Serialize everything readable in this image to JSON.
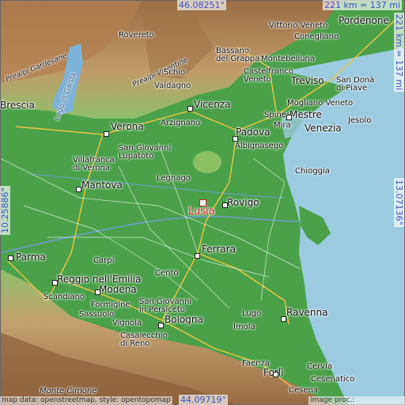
{
  "colors": {
    "lowland": "#4aa14a",
    "mountain": "#b08a5a",
    "sea": "#9ccbe0",
    "marker": "#e0212b",
    "coord": "#3b52c4"
  },
  "coords": {
    "top": "46.08251°",
    "bottom": "44.09719°",
    "left": "10.25886°",
    "right": "13.07136°",
    "scale_top": "221 km = 137 mi",
    "scale_right": "221 km = 137 mi"
  },
  "target": {
    "name": "Lusia"
  },
  "places": [
    {
      "name": "Rovereto",
      "big": false
    },
    {
      "name": "Vittorio Veneto",
      "big": false
    },
    {
      "name": "Pordenone",
      "big": true
    },
    {
      "name": "Conegliano",
      "big": false
    },
    {
      "name": "Bassano del Grappa",
      "big": false
    },
    {
      "name": "Montebelluna",
      "big": false
    },
    {
      "name": "Schio",
      "big": false
    },
    {
      "name": "Valdagno",
      "big": false
    },
    {
      "name": "Castelfranco Veneto",
      "big": false
    },
    {
      "name": "Treviso",
      "big": true
    },
    {
      "name": "San Donà di Piave",
      "big": false
    },
    {
      "name": "Brescia",
      "big": true
    },
    {
      "name": "Vicenza",
      "big": true
    },
    {
      "name": "Mogliano Veneto",
      "big": false
    },
    {
      "name": "Spinea",
      "big": false
    },
    {
      "name": "Mestre",
      "big": true
    },
    {
      "name": "Jesolo",
      "big": false
    },
    {
      "name": "Verona",
      "big": true
    },
    {
      "name": "Arzignano",
      "big": false
    },
    {
      "name": "Padova",
      "big": true
    },
    {
      "name": "Venezia",
      "big": true
    },
    {
      "name": "Mira",
      "big": false
    },
    {
      "name": "Albignasego",
      "big": false
    },
    {
      "name": "San Giovanni Lupatoto",
      "big": false
    },
    {
      "name": "Villafranca di Verona",
      "big": false
    },
    {
      "name": "Chioggia",
      "big": false
    },
    {
      "name": "Mantova",
      "big": true
    },
    {
      "name": "Legnago",
      "big": false
    },
    {
      "name": "Rovigo",
      "big": true
    },
    {
      "name": "Ferrara",
      "big": true
    },
    {
      "name": "Parma",
      "big": true
    },
    {
      "name": "Carpi",
      "big": false
    },
    {
      "name": "Cento",
      "big": false
    },
    {
      "name": "Reggio nell'Emilia",
      "big": true
    },
    {
      "name": "Modena",
      "big": true
    },
    {
      "name": "Scandiano",
      "big": false
    },
    {
      "name": "Formigine",
      "big": false
    },
    {
      "name": "Sassuolo",
      "big": false
    },
    {
      "name": "San Giovanni in Persiceto",
      "big": false
    },
    {
      "name": "Vignola",
      "big": false
    },
    {
      "name": "Bologna",
      "big": true
    },
    {
      "name": "Casalecchio di Reno",
      "big": false
    },
    {
      "name": "Ravenna",
      "big": true
    },
    {
      "name": "Lugo",
      "big": false
    },
    {
      "name": "Imola",
      "big": false
    },
    {
      "name": "Faenza",
      "big": false
    },
    {
      "name": "Forlì",
      "big": true
    },
    {
      "name": "Cervia",
      "big": false
    },
    {
      "name": "Cesena",
      "big": false
    },
    {
      "name": "Cesenatico",
      "big": false
    },
    {
      "name": "Monte Cimone",
      "big": false
    }
  ],
  "terrain": [
    {
      "name": "Prealpi Gardesane"
    },
    {
      "name": "Lago di Garda"
    },
    {
      "name": "Prealpi Vicentine"
    }
  ],
  "credits": {
    "left": "map data: openstreetmap, style: opentopomap",
    "right": "image proc.: elevation.city"
  }
}
